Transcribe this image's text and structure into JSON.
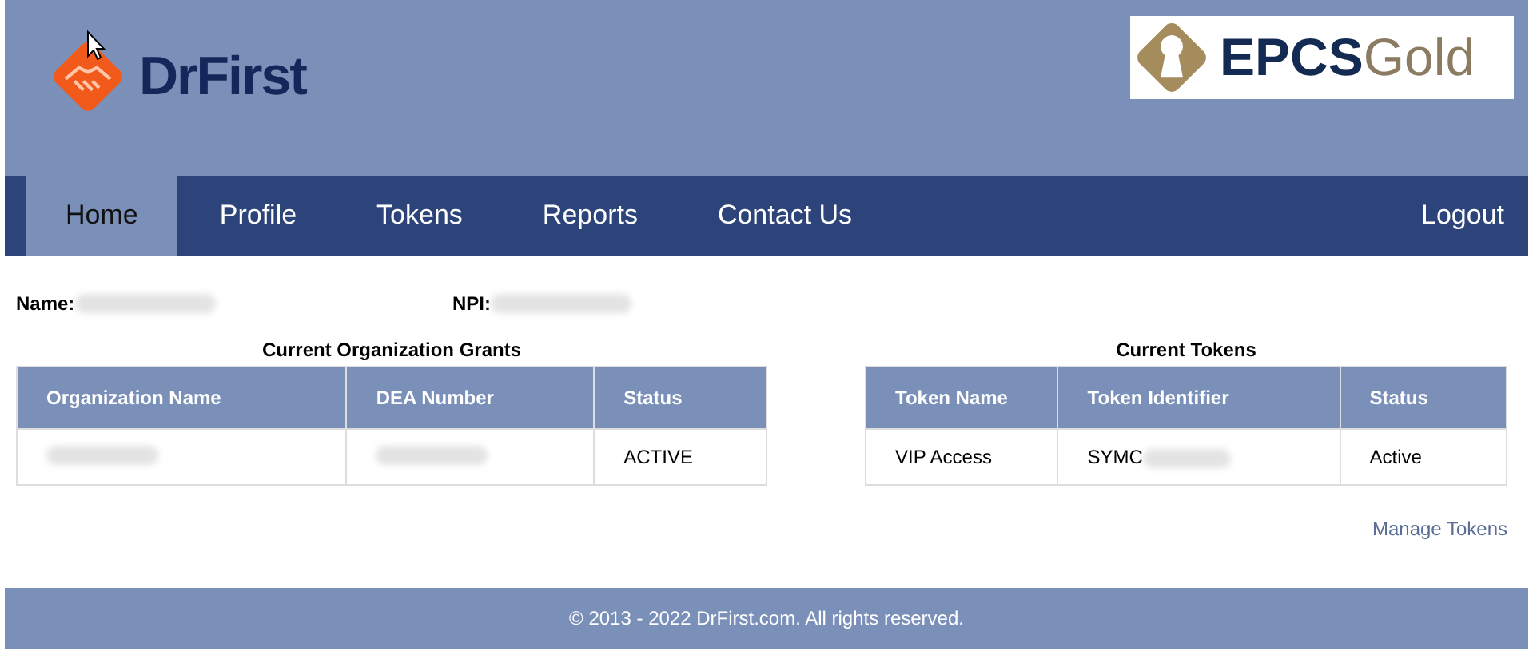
{
  "header": {
    "logo": {
      "text": "DrFirst"
    },
    "badge": {
      "text_bold": "EPCS",
      "text_light": "Gold"
    }
  },
  "nav": {
    "tabs": [
      {
        "label": "Home",
        "selected": true
      },
      {
        "label": "Profile",
        "selected": false
      },
      {
        "label": "Tokens",
        "selected": false
      },
      {
        "label": "Reports",
        "selected": false
      },
      {
        "label": "Contact Us",
        "selected": false
      }
    ],
    "logout": "Logout"
  },
  "info": [
    {
      "label": "Name:",
      "redacted": true
    },
    {
      "label": "NPI:",
      "redacted": true
    }
  ],
  "tables": [
    {
      "title": "Current Organization Grants",
      "columns": [
        "Organization Name",
        "DEA Number",
        "Status"
      ],
      "rows": [
        [
          {
            "redacted": true
          },
          {
            "redacted": true
          },
          {
            "text": "ACTIVE"
          }
        ]
      ]
    },
    {
      "title": "Current Tokens",
      "columns": [
        "Token Name",
        "Token Identifier",
        "Status"
      ],
      "rows": [
        [
          {
            "text": "VIP Access"
          },
          {
            "text": "SYMC",
            "redacted": true
          },
          {
            "text": "Active"
          }
        ]
      ]
    }
  ],
  "manage_link": "Manage Tokens",
  "footer": "© 2013 - 2022 DrFirst.com. All rights reserved."
}
